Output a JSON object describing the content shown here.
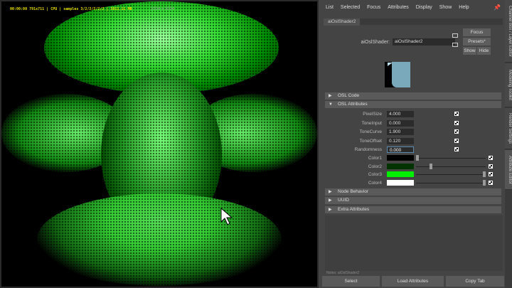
{
  "render_view": {
    "hud": "00:00:00 791x711 | CPU | samples 3/2/2/2/2/2 | 5811.11 MB",
    "resolution": "1024 x 1024"
  },
  "menu": [
    "List",
    "Selected",
    "Focus",
    "Attributes",
    "Display",
    "Show",
    "Help"
  ],
  "tab": "aiOslShader2",
  "node": {
    "label": "aiOslShader:",
    "value": "aiOslShader2"
  },
  "buttons": {
    "focus": "Focus",
    "presets": "Presets*",
    "show": "Show",
    "hide": "Hide"
  },
  "sections": {
    "osl_code": "OSL Code",
    "osl_attributes": "OSL Attributes",
    "node_behavior": "Node Behavior",
    "uuid": "UUID",
    "extra": "Extra Attributes"
  },
  "attributes": [
    {
      "label": "PixelSize",
      "value": "4.000"
    },
    {
      "label": "ToneInput",
      "value": "0.000"
    },
    {
      "label": "ToneCurve",
      "value": "1.900"
    },
    {
      "label": "ToneOffset",
      "value": "0.120"
    },
    {
      "label": "Randomness",
      "value": "0.000"
    }
  ],
  "colors": [
    {
      "label": "Color1",
      "hex": "#000000",
      "slider": 0.0
    },
    {
      "label": "Color2",
      "hex": "#003300",
      "slider": 0.2
    },
    {
      "label": "Color3",
      "hex": "#00ee00",
      "slider": 1.0
    },
    {
      "label": "Color4",
      "hex": "#ffffff",
      "slider": 1.0
    }
  ],
  "notes": "Notes: aiOslShader2",
  "bottom_buttons": {
    "select": "Select",
    "load": "Load Attributes",
    "copy": "Copy Tab"
  },
  "side_tabs": [
    "Channel Box / Layer Editor",
    "Modeling Toolkit",
    "Render Settings",
    "Attribute Editor"
  ]
}
